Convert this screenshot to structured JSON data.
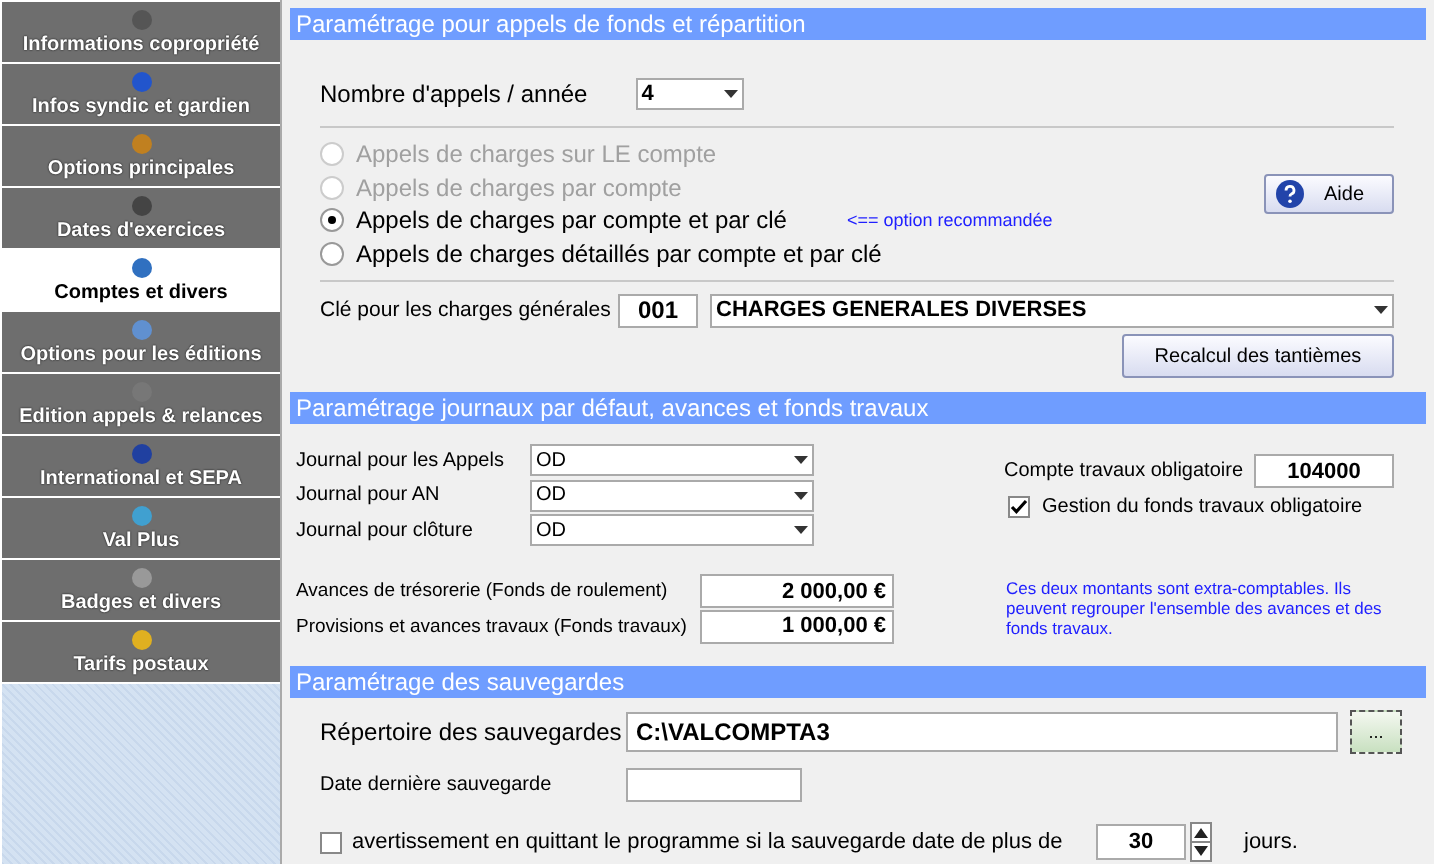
{
  "sidebar": {
    "items": [
      {
        "label": "Informations copropriété",
        "selected": false
      },
      {
        "label": "Infos syndic et gardien",
        "selected": false
      },
      {
        "label": "Options principales",
        "selected": false
      },
      {
        "label": "Dates d'exercices",
        "selected": false
      },
      {
        "label": "Comptes et divers",
        "selected": true
      },
      {
        "label": "Options pour les éditions",
        "selected": false
      },
      {
        "label": "Edition appels & relances",
        "selected": false
      },
      {
        "label": "International et SEPA",
        "selected": false
      },
      {
        "label": "Val Plus",
        "selected": false
      },
      {
        "label": "Badges et divers",
        "selected": false
      },
      {
        "label": "Tarifs postaux",
        "selected": false
      }
    ]
  },
  "appels": {
    "title": "Paramétrage pour appels de fonds et répartition",
    "nombre_label": "Nombre d'appels / année",
    "nombre_value": "4",
    "options": [
      {
        "label": "Appels de charges sur LE compte",
        "selected": false,
        "disabled": true
      },
      {
        "label": "Appels de charges par compte",
        "selected": false,
        "disabled": true
      },
      {
        "label": "Appels de charges par compte et par clé",
        "selected": true,
        "disabled": false
      },
      {
        "label": "Appels de charges détaillés par compte et par clé",
        "selected": false,
        "disabled": false
      }
    ],
    "recommended_note": "<== option recommandée",
    "help_button": "Aide",
    "cle_label": "Clé pour les charges générales",
    "cle_code": "001",
    "cle_name": "CHARGES GENERALES DIVERSES",
    "recalc_button": "Recalcul des tantièmes"
  },
  "journaux": {
    "title": "Paramétrage journaux par défaut, avances et fonds travaux",
    "journals": [
      {
        "label": "Journal pour les Appels",
        "value": "OD"
      },
      {
        "label": "Journal pour AN",
        "value": "OD"
      },
      {
        "label": "Journal pour clôture",
        "value": "OD"
      }
    ],
    "compte_label": "Compte travaux obligatoire",
    "compte_value": "104000",
    "gestion": {
      "label": "Gestion du fonds travaux obligatoire",
      "checked": true
    },
    "amounts": [
      {
        "label": "Avances de trésorerie (Fonds de roulement)",
        "value": "2 000,00 €"
      },
      {
        "label": "Provisions et avances travaux (Fonds travaux)",
        "value": "1 000,00 €"
      }
    ],
    "note": "Ces deux montants sont extra-comptables. Ils peuvent regrouper l'ensemble des avances et des fonds travaux."
  },
  "sauvegardes": {
    "title": "Paramétrage des sauvegardes",
    "dir_label": "Répertoire des sauvegardes",
    "dir_value": "C:\\VALCOMPTA3",
    "browse_button": "...",
    "date_label": "Date dernière sauvegarde",
    "warn": {
      "label": "avertissement en quittant le programme si la sauvegarde date de plus de",
      "checked": false
    },
    "days_value": "30",
    "days_unit": "jours."
  }
}
